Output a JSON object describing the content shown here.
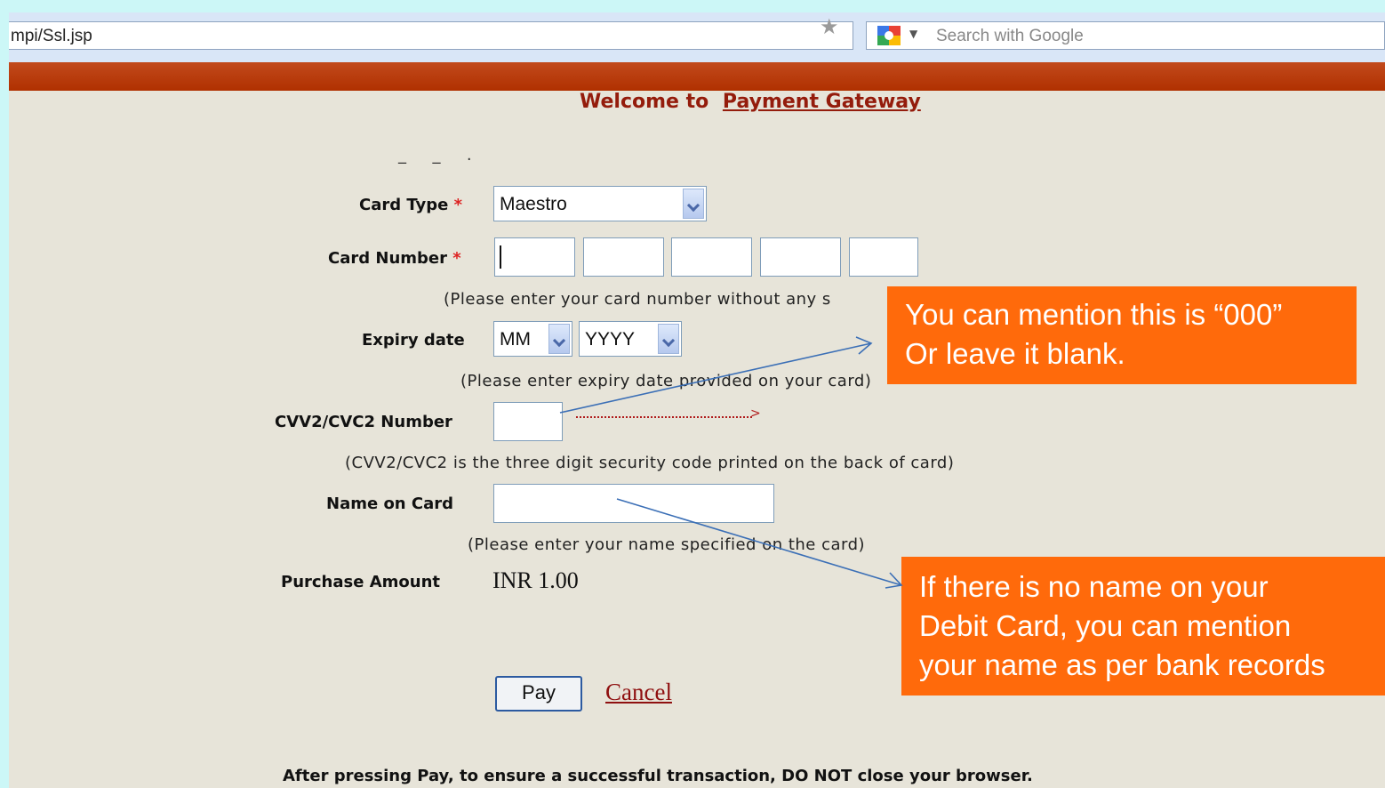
{
  "browser": {
    "url": "mpi/Ssl.jsp",
    "search_placeholder": "Search with Google"
  },
  "page": {
    "welcome_prefix": "Welcome to",
    "welcome_link": "Payment Gateway",
    "card_type_label": "Card Type",
    "card_type_value": "Maestro",
    "card_number_label": "Card Number",
    "card_number_hint": "(Please enter your card number without any s",
    "expiry_label": "Expiry date",
    "expiry_month": "MM",
    "expiry_year": "YYYY",
    "expiry_hint": "(Please enter expiry date provided on your card)",
    "cvv_label": "CVV2/CVC2 Number",
    "cvv_hint": "(CVV2/CVC2 is the three digit security code printed on the back of card)",
    "name_label": "Name on Card",
    "name_hint": "(Please enter your name specified on the card)",
    "amount_label": "Purchase Amount",
    "amount_value": "INR  1.00",
    "pay_button": "Pay",
    "cancel_link": "Cancel",
    "footer_note": "After pressing Pay, to ensure a successful transaction, DO NOT close your browser."
  },
  "callouts": {
    "cvv_line1": "You can mention this is “000”",
    "cvv_line2": "Or leave it blank.",
    "name_line1": "If there is no name on your",
    "name_line2": "Debit Card, you can mention",
    "name_line3": "your name as per bank records"
  },
  "colors": {
    "header_bar": "#b53402",
    "page_bg": "#e7e4d9",
    "callout_bg": "#ff6a0b",
    "title_red": "#941c0c"
  }
}
